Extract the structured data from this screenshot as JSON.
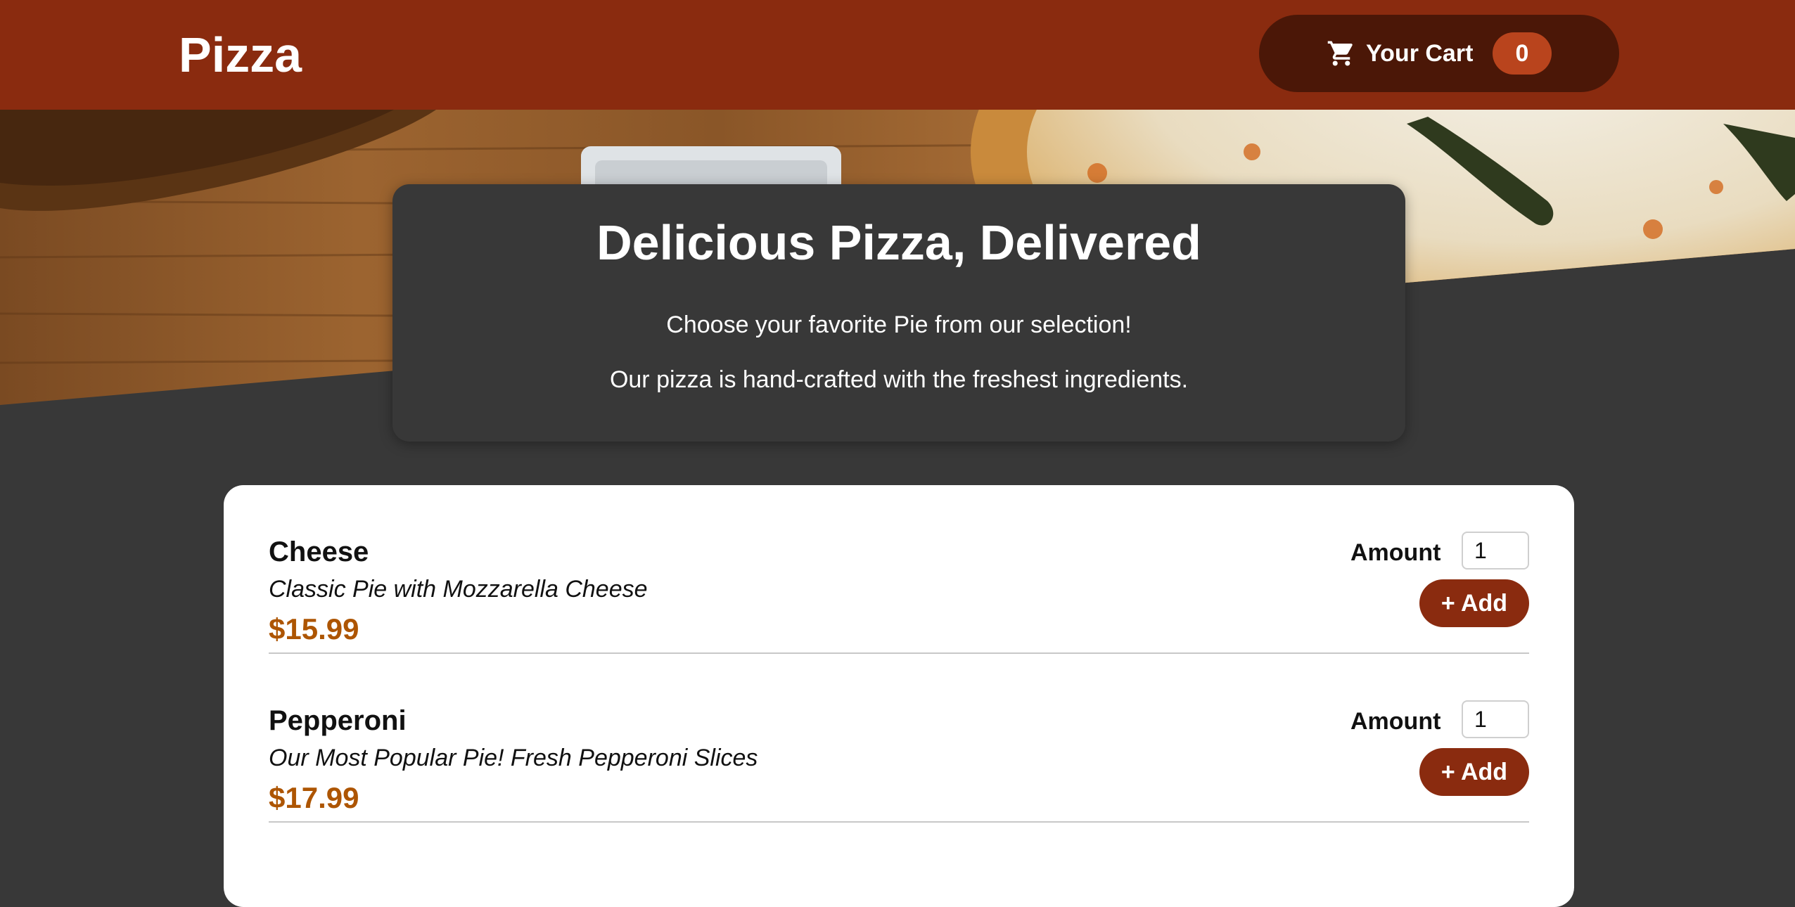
{
  "header": {
    "brand": "Pizza",
    "cart": {
      "label": "Your Cart",
      "count": "0",
      "icon": "cart-icon"
    }
  },
  "summary": {
    "title": "Delicious Pizza, Delivered",
    "line1": "Choose your favorite Pie from our selection!",
    "line2": "Our pizza is hand-crafted with the freshest ingredients."
  },
  "meals": [
    {
      "name": "Cheese",
      "description": "Classic Pie with Mozzarella Cheese",
      "price": "$15.99",
      "amount_label": "Amount",
      "amount": "1",
      "add_label": "+ Add"
    },
    {
      "name": "Pepperoni",
      "description": "Our Most Popular Pie! Fresh Pepperoni Slices",
      "price": "$17.99",
      "amount_label": "Amount",
      "amount": "1",
      "add_label": "+ Add"
    }
  ],
  "colors": {
    "header": "#8a2b0f",
    "cart_button": "#4b1707",
    "badge": "#b9441d",
    "price": "#ad5502",
    "background": "#383838"
  }
}
